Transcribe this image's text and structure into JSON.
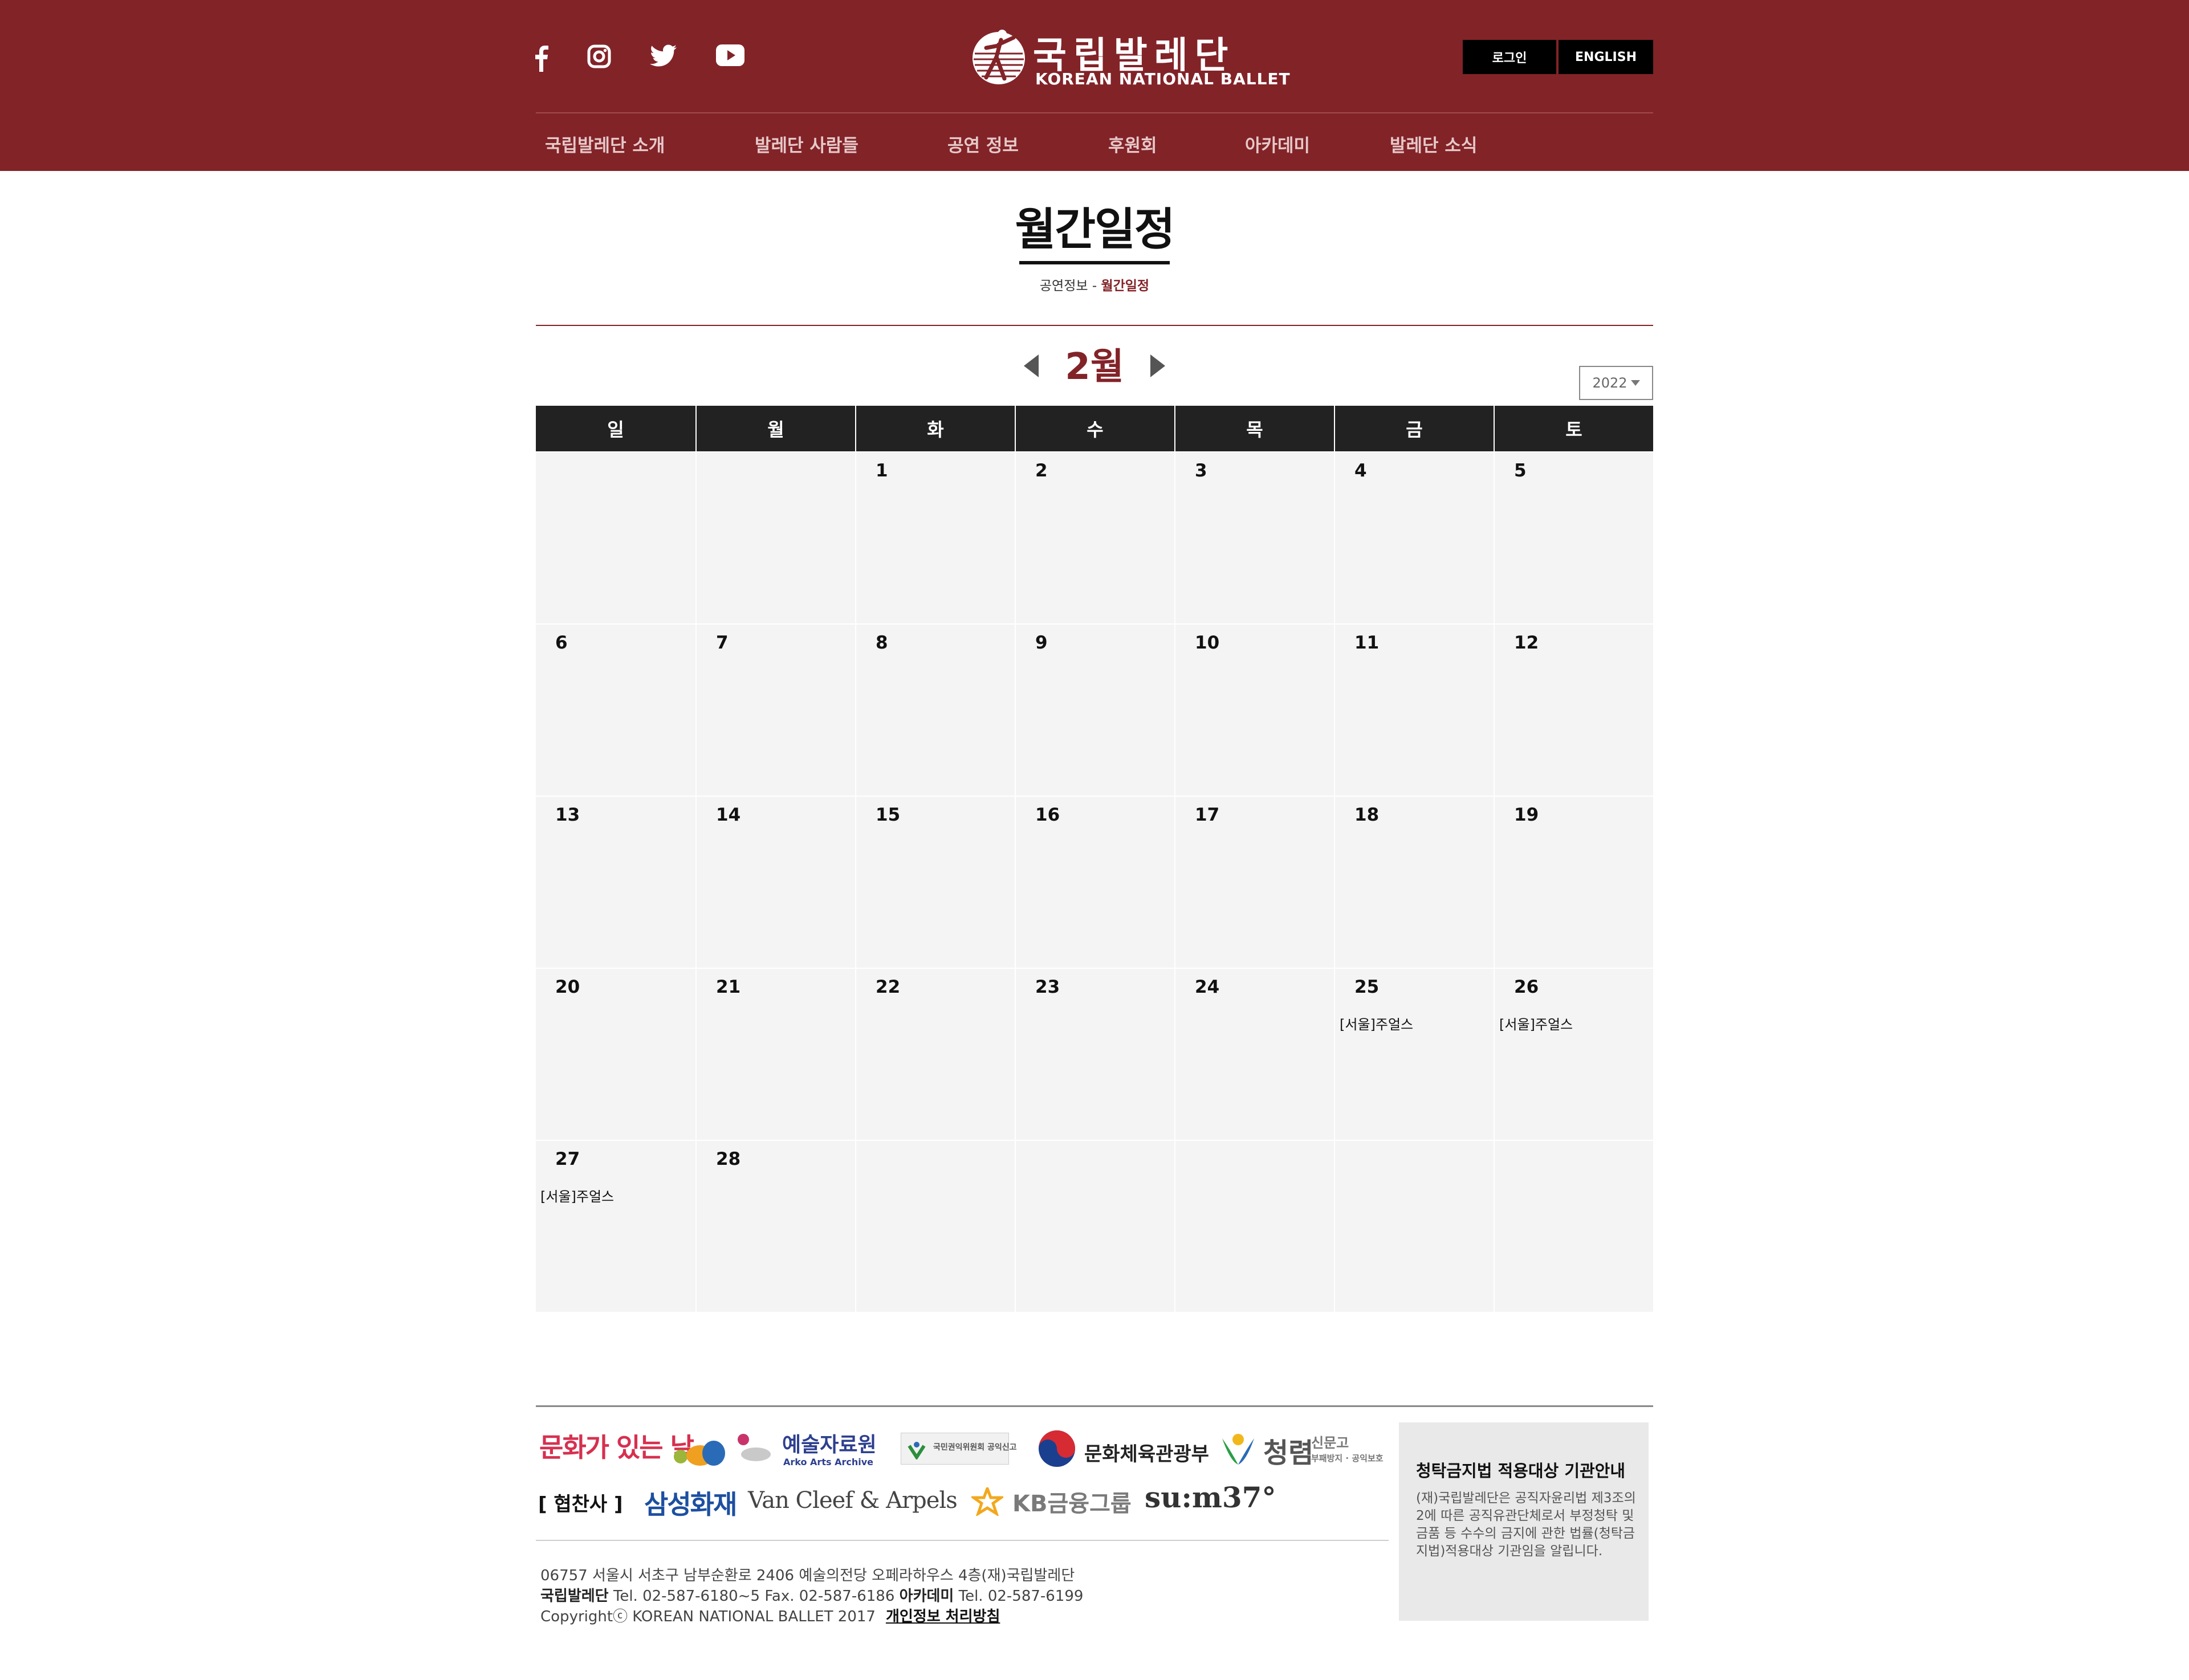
{
  "header": {
    "brand_korean": "국립발레단",
    "brand_english": "KOREAN NATIONAL BALLET",
    "login_label": "로그인",
    "english_label": "ENGLISH",
    "social_icons": [
      "facebook-icon",
      "instagram-icon",
      "twitter-icon",
      "youtube-icon"
    ],
    "nav": [
      "국립발레단 소개",
      "발레단 사람들",
      "공연 정보",
      "후원회",
      "아카데미",
      "발레단 소식"
    ]
  },
  "page": {
    "title": "월간일정",
    "breadcrumb_parent": "공연정보",
    "breadcrumb_sep": " - ",
    "breadcrumb_current": "월간일정"
  },
  "calendar": {
    "month_label": "2월",
    "year": "2022",
    "weekdays": [
      "일",
      "월",
      "화",
      "수",
      "목",
      "금",
      "토"
    ],
    "weeks": [
      [
        {
          "day": "",
          "event": ""
        },
        {
          "day": "",
          "event": ""
        },
        {
          "day": "1",
          "event": ""
        },
        {
          "day": "2",
          "event": ""
        },
        {
          "day": "3",
          "event": ""
        },
        {
          "day": "4",
          "event": ""
        },
        {
          "day": "5",
          "event": ""
        }
      ],
      [
        {
          "day": "6",
          "event": ""
        },
        {
          "day": "7",
          "event": ""
        },
        {
          "day": "8",
          "event": ""
        },
        {
          "day": "9",
          "event": ""
        },
        {
          "day": "10",
          "event": ""
        },
        {
          "day": "11",
          "event": ""
        },
        {
          "day": "12",
          "event": ""
        }
      ],
      [
        {
          "day": "13",
          "event": ""
        },
        {
          "day": "14",
          "event": ""
        },
        {
          "day": "15",
          "event": ""
        },
        {
          "day": "16",
          "event": ""
        },
        {
          "day": "17",
          "event": ""
        },
        {
          "day": "18",
          "event": ""
        },
        {
          "day": "19",
          "event": ""
        }
      ],
      [
        {
          "day": "20",
          "event": ""
        },
        {
          "day": "21",
          "event": ""
        },
        {
          "day": "22",
          "event": ""
        },
        {
          "day": "23",
          "event": ""
        },
        {
          "day": "24",
          "event": ""
        },
        {
          "day": "25",
          "event": "[서울]주얼스"
        },
        {
          "day": "26",
          "event": "[서울]주얼스"
        }
      ],
      [
        {
          "day": "27",
          "event": "[서울]주얼스"
        },
        {
          "day": "28",
          "event": ""
        },
        {
          "day": "",
          "event": ""
        },
        {
          "day": "",
          "event": ""
        },
        {
          "day": "",
          "event": ""
        },
        {
          "day": "",
          "event": ""
        },
        {
          "day": "",
          "event": ""
        }
      ]
    ]
  },
  "footer": {
    "partners_row1": [
      "문화가 있는 날",
      "예술자료원",
      "Arko Arts Archive",
      "국민권익위원회 공익신고",
      "문화체육관광부",
      "청렴",
      "신문고",
      "부패방지 · 공익보호"
    ],
    "sponsor_label": "[ 협찬사 ]",
    "sponsors": [
      "삼성화재",
      "Van Cleef & Arpels",
      "KB금융그룹",
      "su:m37°"
    ],
    "address": "06757 서울시 서초구 남부순환로 2406 예술의전당 오페라하우스 4층(재)국립발레단",
    "contact_ballet_label": "국립발레단",
    "contact_ballet": " Tel. 02-587-6180~5 Fax. 02-587-6186 ",
    "contact_academy_label": "아카데미",
    "contact_academy": " Tel. 02-587-6199",
    "copyright": "Copyrightⓒ KOREAN NATIONAL BALLET 2017",
    "privacy_label": "개인정보 처리방침",
    "notice_title": "청탁금지법 적용대상 기관안내",
    "notice_body": "(재)국립발레단은 공직자윤리법 제3조의2에 따른 공직유관단체로서 부정청탁 및 금품 등 수수의 금지에 관한 법률(청탁금지법)적용대상 기관임을 알립니다."
  },
  "colors": {
    "brand": "#822328",
    "calendar_header": "#222222",
    "cell_bg": "#f4f4f4"
  }
}
